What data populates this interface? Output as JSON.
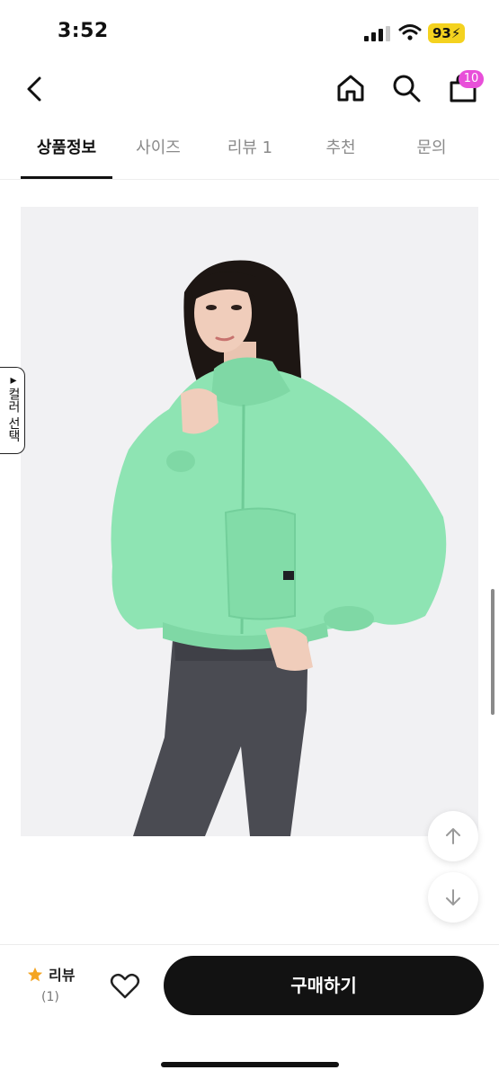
{
  "status_bar": {
    "time": "3:52",
    "battery": "93"
  },
  "nav": {
    "cart_count": "10"
  },
  "tabs": [
    {
      "label": "상품정보",
      "active": true
    },
    {
      "label": "사이즈",
      "active": false
    },
    {
      "label": "리뷰 1",
      "active": false
    },
    {
      "label": "추천",
      "active": false
    },
    {
      "label": "문의",
      "active": false
    }
  ],
  "side_tab": {
    "label": "▸컬러 선택"
  },
  "bottom_bar": {
    "review_label": "리뷰",
    "review_count": "(1)",
    "buy_label": "구매하기"
  },
  "colors": {
    "jacket": "#8ee4b3",
    "leggings": "#4a4b52",
    "badge": "#e84fd9",
    "battery": "#f4d21f",
    "star": "#f4a522",
    "buy_button": "#121212"
  },
  "icons": [
    "back-icon",
    "home-icon",
    "search-icon",
    "bag-icon",
    "star-icon",
    "heart-icon",
    "arrow-up-icon",
    "arrow-down-icon"
  ]
}
